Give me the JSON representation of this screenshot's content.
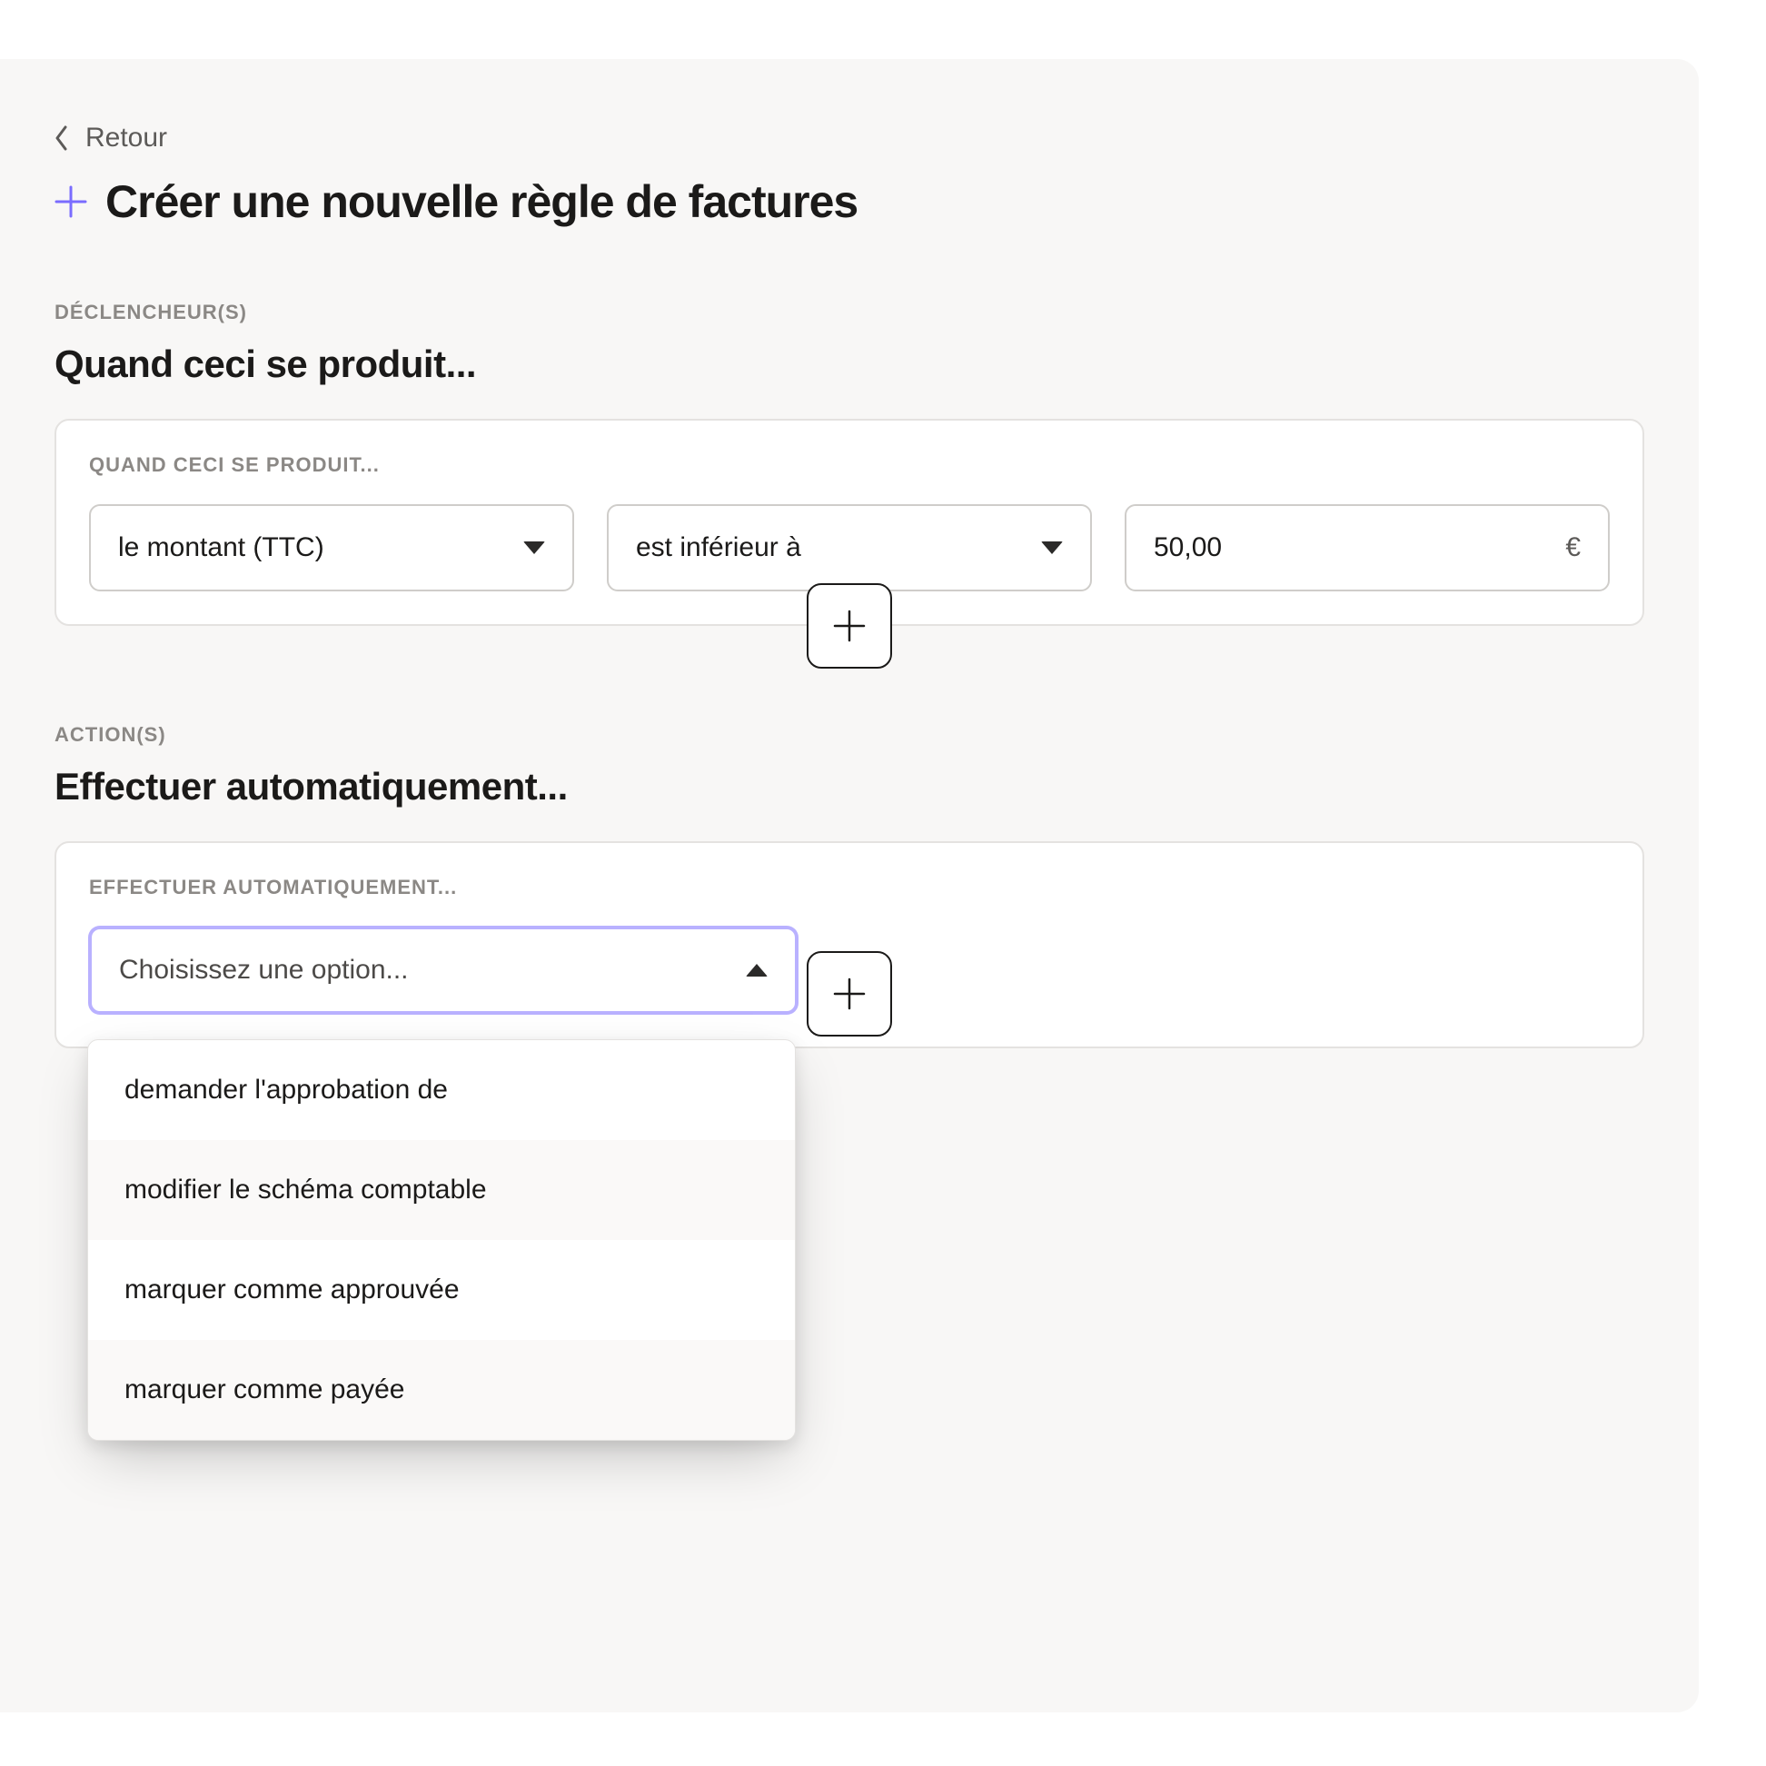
{
  "header": {
    "back_label": "Retour",
    "title": "Créer une nouvelle règle de factures"
  },
  "triggers": {
    "overline": "DÉCLENCHEUR(S)",
    "heading": "Quand ceci se produit...",
    "card_overline": "QUAND CECI SE PRODUIT...",
    "field_select": "le montant (TTC)",
    "operator_select": "est inférieur à",
    "amount_value": "50,00",
    "amount_currency": "€"
  },
  "actions": {
    "overline": "ACTION(S)",
    "heading": "Effectuer automatiquement...",
    "card_overline": "EFFECTUER AUTOMATIQUEMENT...",
    "select_placeholder": "Choisissez une option...",
    "options": [
      "demander l'approbation de",
      "modifier le schéma comptable",
      "marquer comme approuvée",
      "marquer comme payée"
    ]
  }
}
